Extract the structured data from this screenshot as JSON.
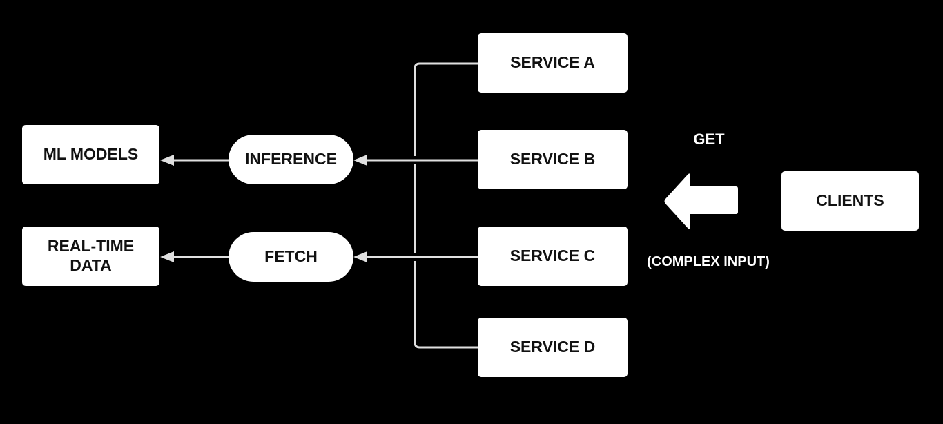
{
  "nodes": {
    "ml_models": "ML MODELS",
    "real_time_data": "REAL-TIME\nDATA",
    "inference": "INFERENCE",
    "fetch": "FETCH",
    "service_a": "SERVICE A",
    "service_b": "SERVICE B",
    "service_c": "SERVICE C",
    "service_d": "SERVICE D",
    "clients": "CLIENTS"
  },
  "labels": {
    "get": "GET",
    "complex_input": "(COMPLEX INPUT)"
  },
  "colors": {
    "background": "#000000",
    "box": "#ffffff",
    "line": "#e0e0e0"
  }
}
